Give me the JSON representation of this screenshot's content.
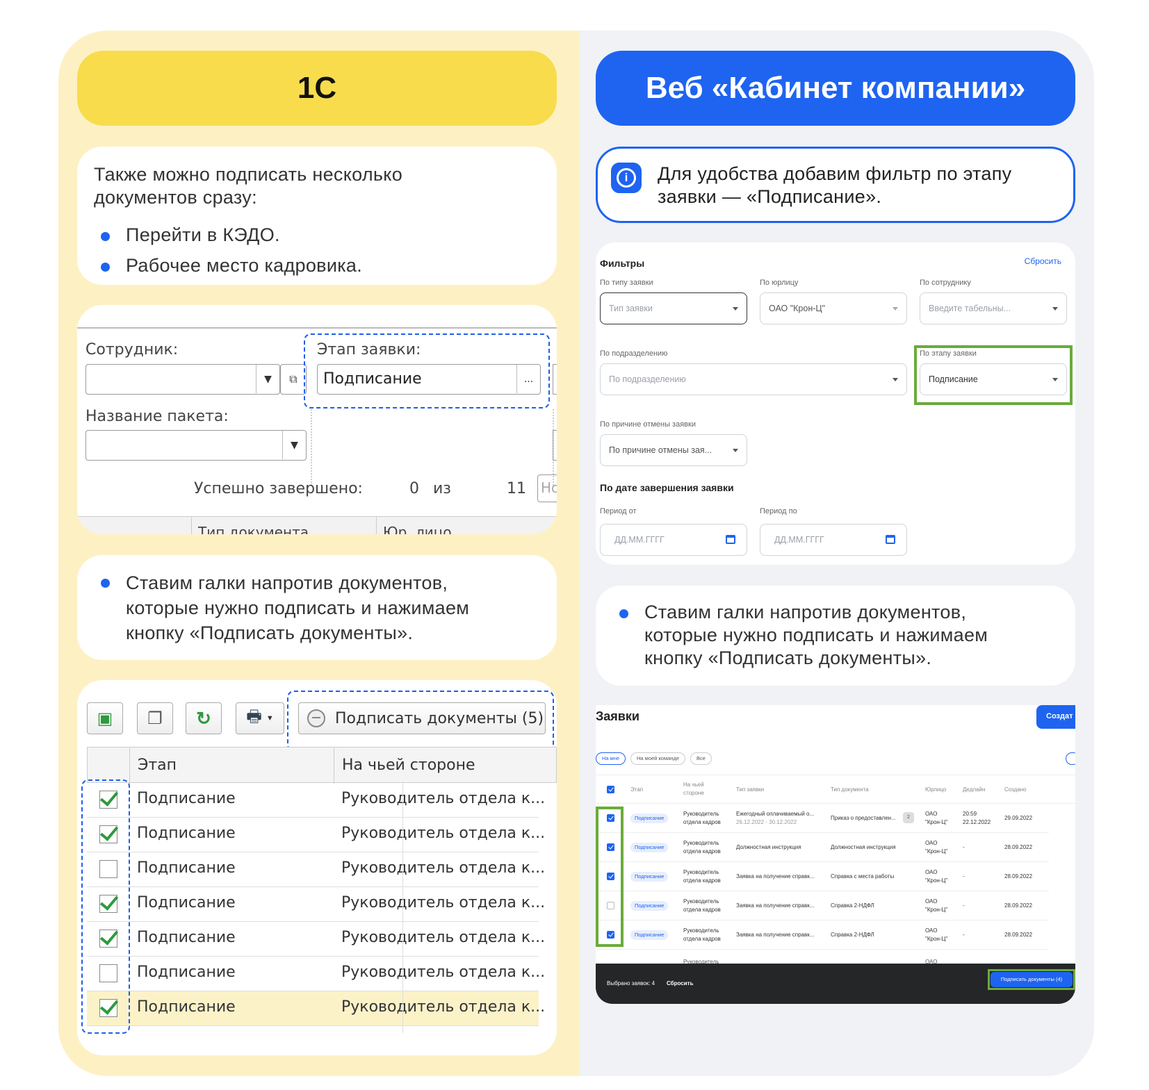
{
  "left": {
    "header": "1С",
    "intro": {
      "text": "Также можно подписать несколько документов сразу:",
      "bullets": [
        "Перейти в КЭДО.",
        "Рабочее место кадровика."
      ]
    },
    "form": {
      "employee_label": "Сотрудник:",
      "stage_label": "Этап заявки:",
      "stage_value": "Подписание",
      "package_label": "Название пакета:",
      "done_label": "Успешно завершено:",
      "done_count": "0",
      "of": "из",
      "total": "11",
      "cut_input": "Но",
      "cut_col1": "Тип документа",
      "cut_col2": "Юр. лицо"
    },
    "step2": "Ставим галки напротив документов, которые нужно подписать и нажимаем кнопку «Подписать документы».",
    "grid": {
      "sign_button": "Подписать документы (5)",
      "col_stage": "Этап",
      "col_side": "На чьей стороне",
      "rows": [
        {
          "checked": true,
          "stage": "Подписание",
          "side": "Руководитель отдела к..."
        },
        {
          "checked": true,
          "stage": "Подписание",
          "side": "Руководитель отдела к..."
        },
        {
          "checked": false,
          "stage": "Подписание",
          "side": "Руководитель отдела к..."
        },
        {
          "checked": true,
          "stage": "Подписание",
          "side": "Руководитель отдела к..."
        },
        {
          "checked": true,
          "stage": "Подписание",
          "side": "Руководитель отдела к..."
        },
        {
          "checked": false,
          "stage": "Подписание",
          "side": "Руководитель отдела к..."
        },
        {
          "checked": true,
          "stage": "Подписание",
          "side": "Руководитель отдела к..."
        }
      ]
    }
  },
  "right": {
    "header": "Веб «Кабинет компании»",
    "info": "Для удобства добавим фильтр по этапу заявки — «Подписание».",
    "filters": {
      "title": "Фильтры",
      "reset": "Сбросить",
      "by_type_label": "По типу заявки",
      "by_type_ph": "Тип заявки",
      "by_entity_label": "По юрлицу",
      "by_entity_val": "ОАО \"Крон-Ц\"",
      "by_employee_label": "По сотруднику",
      "by_employee_ph": "Введите табельны...",
      "by_dept_label": "По подразделению",
      "by_dept_ph": "По подразделению",
      "by_stage_label": "По этапу заявки",
      "by_stage_val": "Подписание",
      "by_cancel_label": "По причине отмены заявки",
      "by_cancel_ph": "По причине отмены зая...",
      "by_date_title": "По дате завершения заявки",
      "period_from_label": "Период от",
      "period_to_label": "Период по",
      "date_ph": "ДД.ММ.ГГГГ"
    },
    "step2": "Ставим галки напротив документов, которые нужно подписать и нажимаем кнопку «Подписать документы».",
    "table": {
      "title": "Заявки",
      "create_button": "Создат",
      "tabs": [
        "На мне",
        "На моей команде",
        "Все"
      ],
      "cols": [
        "Этап",
        "На чьей стороне",
        "Тип заявки",
        "Тип документа",
        "Юрлицо",
        "Дедлайн",
        "Создано"
      ],
      "rows": [
        {
          "checked": true,
          "stage": "Подписание",
          "side": "Руководитель отдела кадров",
          "type": "Ежегодный оплачиваемый о...",
          "type_sub": "26.12.2022 - 30.12.2022",
          "doc": "Приказ о предоставлен...",
          "badge": "2",
          "entity": "ОАО \"Крон-Ц\"",
          "deadline": "20:59 22.12.2022",
          "created": "29.09.2022"
        },
        {
          "checked": true,
          "stage": "Подписание",
          "side": "Руководитель отдела кадров",
          "type": "Должностная инструкция",
          "type_sub": "",
          "doc": "Должностная инструкция",
          "badge": "",
          "entity": "ОАО \"Крон-Ц\"",
          "deadline": "-",
          "created": "28.09.2022"
        },
        {
          "checked": true,
          "stage": "Подписание",
          "side": "Руководитель отдела кадров",
          "type": "Заявка на получение справк...",
          "type_sub": "",
          "doc": "Справка с места работы",
          "badge": "",
          "entity": "ОАО \"Крон-Ц\"",
          "deadline": "-",
          "created": "28.09.2022"
        },
        {
          "checked": false,
          "stage": "Подписание",
          "side": "Руководитель отдела кадров",
          "type": "Заявка на получение справк...",
          "type_sub": "",
          "doc": "Справка 2-НДФЛ",
          "badge": "",
          "entity": "ОАО \"Крон-Ц\"",
          "deadline": "-",
          "created": "28.09.2022"
        },
        {
          "checked": true,
          "stage": "Подписание",
          "side": "Руководитель отдела кадров",
          "type": "Заявка на получение справк...",
          "type_sub": "",
          "doc": "Справка 2-НДФЛ",
          "badge": "",
          "entity": "ОАО \"Крон-Ц\"",
          "deadline": "-",
          "created": "28.09.2022"
        }
      ],
      "cut_side": "Руководитель",
      "cut_entity": "ОАО",
      "selected": "Выбрано заявок: 4",
      "reset": "Сбросить",
      "sign_button": "Подписать документы (4)"
    }
  }
}
